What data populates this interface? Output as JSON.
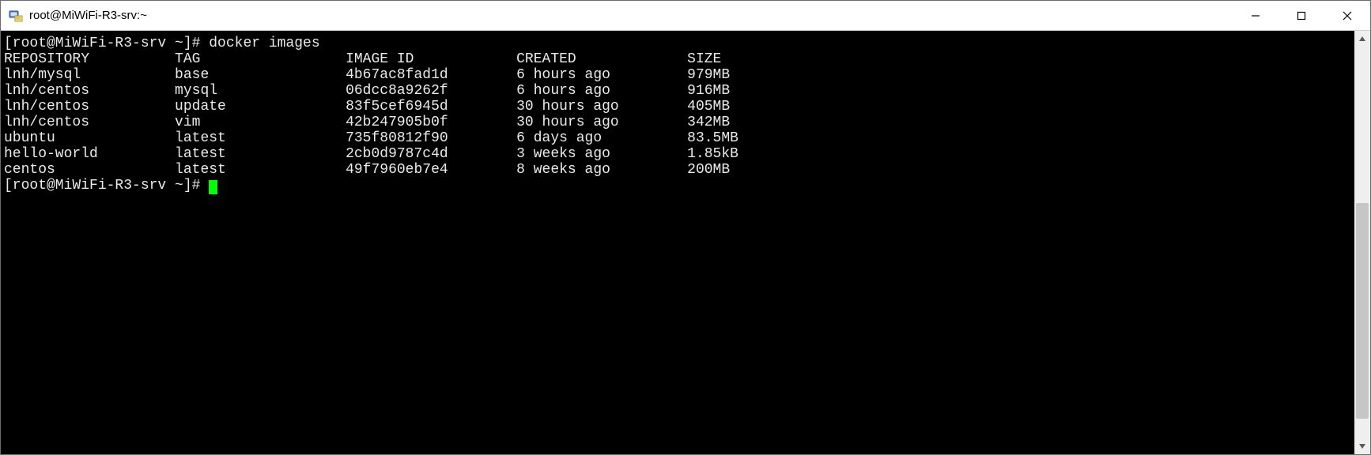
{
  "window": {
    "title": "root@MiWiFi-R3-srv:~"
  },
  "terminal": {
    "prompt1_user": "[root@MiWiFi-R3-srv ~]# ",
    "command1": "docker images",
    "headers": {
      "repository": "REPOSITORY",
      "tag": "TAG",
      "image_id": "IMAGE ID",
      "created": "CREATED",
      "size": "SIZE"
    },
    "rows": [
      {
        "repository": "lnh/mysql",
        "tag": "base",
        "image_id": "4b67ac8fad1d",
        "created": "6 hours ago",
        "size": "979MB"
      },
      {
        "repository": "lnh/centos",
        "tag": "mysql",
        "image_id": "06dcc8a9262f",
        "created": "6 hours ago",
        "size": "916MB"
      },
      {
        "repository": "lnh/centos",
        "tag": "update",
        "image_id": "83f5cef6945d",
        "created": "30 hours ago",
        "size": "405MB"
      },
      {
        "repository": "lnh/centos",
        "tag": "vim",
        "image_id": "42b247905b0f",
        "created": "30 hours ago",
        "size": "342MB"
      },
      {
        "repository": "ubuntu",
        "tag": "latest",
        "image_id": "735f80812f90",
        "created": "6 days ago",
        "size": "83.5MB"
      },
      {
        "repository": "hello-world",
        "tag": "latest",
        "image_id": "2cb0d9787c4d",
        "created": "3 weeks ago",
        "size": "1.85kB"
      },
      {
        "repository": "centos",
        "tag": "latest",
        "image_id": "49f7960eb7e4",
        "created": "8 weeks ago",
        "size": "200MB"
      }
    ],
    "prompt2_user": "[root@MiWiFi-R3-srv ~]# ",
    "col_widths": {
      "repository": 20,
      "tag": 20,
      "image_id": 20,
      "created": 20
    }
  }
}
